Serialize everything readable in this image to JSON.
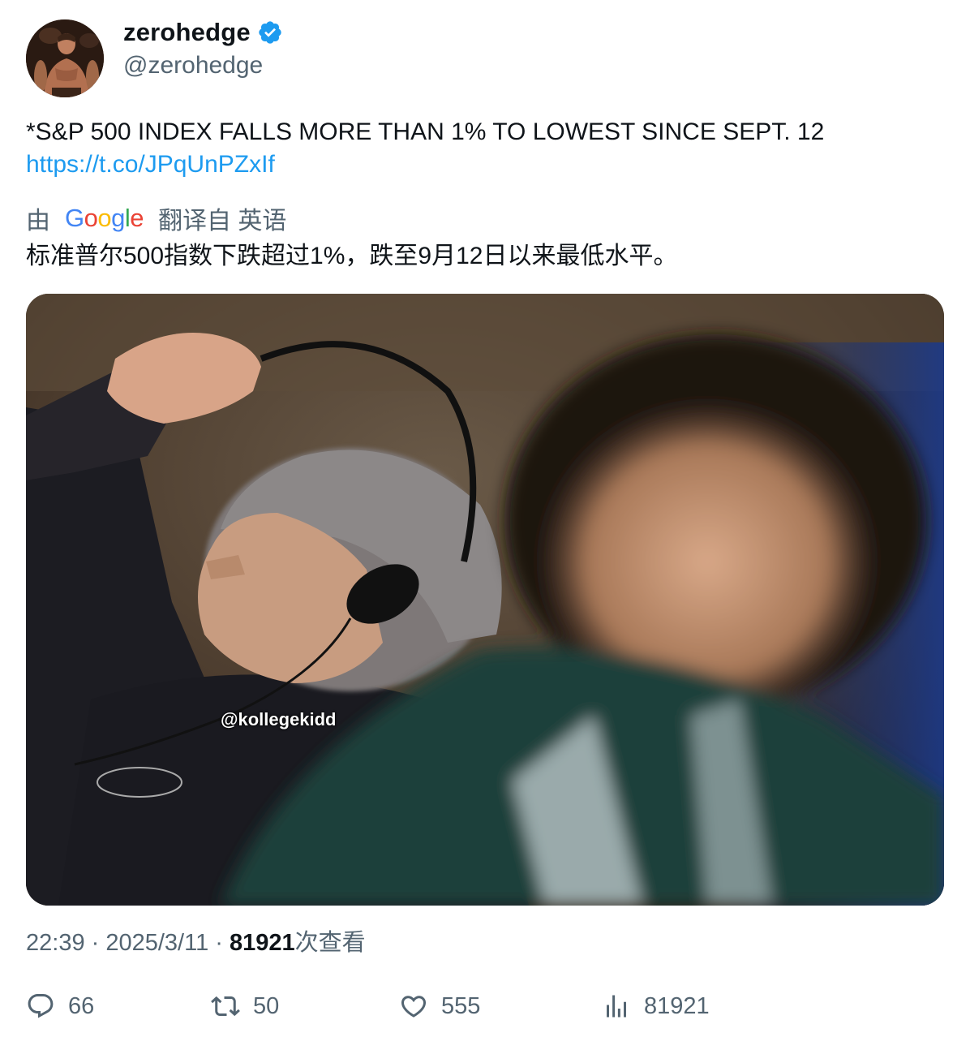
{
  "author": {
    "display_name": "zerohedge",
    "handle": "@zerohedge",
    "verified_icon": "verified-badge-icon",
    "verified_color": "#1d9bf0"
  },
  "tweet": {
    "text": "*S&P 500 INDEX FALLS MORE THAN 1% TO LOWEST SINCE SEPT. 12",
    "link": "https://t.co/JPqUnPZxIf",
    "translation": {
      "prefix": "由",
      "provider_logo": "Google",
      "suffix": "翻译自 英语",
      "text": "标准普尔500指数下跌超过1%，跌至9月12日以来最低水平。"
    },
    "media": {
      "watermark": "@kollegekidd"
    }
  },
  "meta": {
    "time": "22:39",
    "separator": "·",
    "date": "2025/3/11",
    "views_count": "81921",
    "views_label": "次查看"
  },
  "actions": {
    "reply": {
      "icon": "reply-icon",
      "count": "66"
    },
    "retweet": {
      "icon": "retweet-icon",
      "count": "50"
    },
    "like": {
      "icon": "heart-icon",
      "count": "555"
    },
    "views": {
      "icon": "analytics-icon",
      "count": "81921"
    }
  },
  "colors": {
    "link": "#1d9bf0",
    "secondary_text": "#536471",
    "primary_text": "#0f1419"
  }
}
